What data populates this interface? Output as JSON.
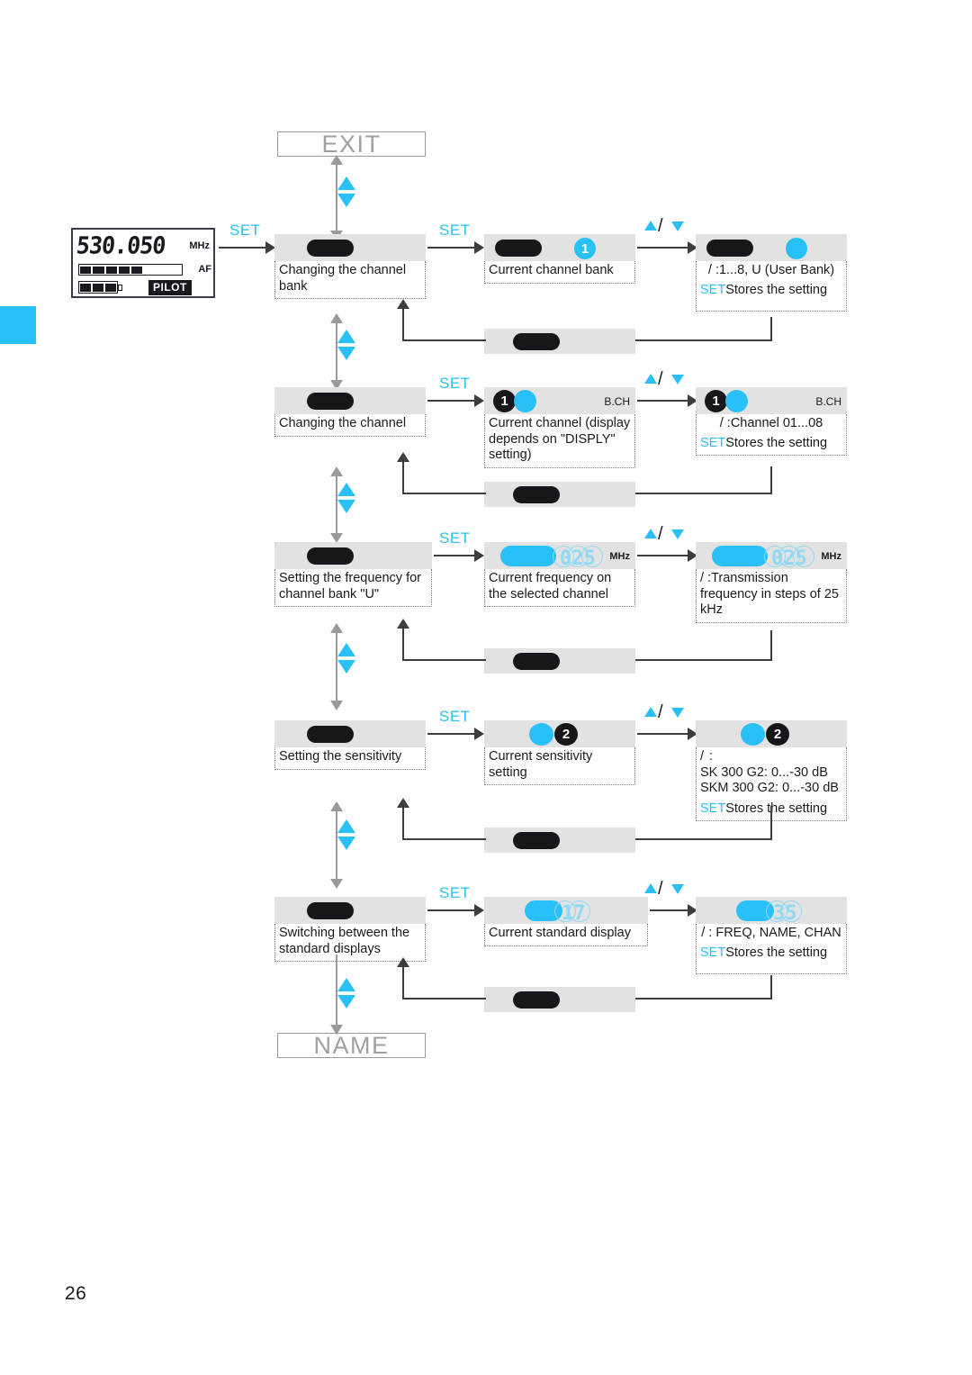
{
  "page": {
    "number": "26",
    "tab_color": "#29c0f7"
  },
  "lcd": {
    "frequency": "530.050",
    "unit": "MHz",
    "af_label": "AF",
    "pilot_label": "PILOT",
    "af_segments_on": 5,
    "af_segments_total": 8,
    "battery_segments_on": 3,
    "battery_segments_total": 3
  },
  "terminals": {
    "exit": "EXIT",
    "name": "NAME"
  },
  "labels": {
    "set": "SET",
    "updown": "/",
    "stores_prefix": "SET",
    "stores_text": "Stores the setting"
  },
  "rows": [
    {
      "id": "channel-bank",
      "menu_caption": "Changing the channel bank",
      "current_caption": "Current channel bank",
      "current_screen": {
        "badge": "1",
        "badge_color": "#29c0f7"
      },
      "edit_value": ":1...8, U (User Bank)",
      "edit_has_store": true,
      "screen_corner_label": ""
    },
    {
      "id": "channel",
      "menu_caption": "Changing the channel",
      "current_caption": "Current channel (display depends on \"DISPLY\" setting)",
      "current_screen": {
        "badge": "1",
        "badge_color": "#17171b"
      },
      "edit_value": ":Channel  01...08",
      "edit_has_store": true,
      "screen_corner_label": "B.CH"
    },
    {
      "id": "frequency",
      "menu_caption": "Setting the frequency for channel bank \"U\"",
      "current_caption": "Current frequency on the selected channel",
      "current_screen": {
        "ghost": "025",
        "unit": "MHz"
      },
      "edit_value": ":Transmission frequency in steps of 25 kHz",
      "edit_has_store": false,
      "screen_corner_label": ""
    },
    {
      "id": "sensitivity",
      "menu_caption": "Setting the sensitivity",
      "current_caption": "Current sensitivity setting",
      "current_screen": {
        "badge": "2",
        "badge_color": "#17171b"
      },
      "edit_value": ":",
      "edit_lines": [
        "SK 300 G2: 0...-30 dB",
        "SKM 300 G2: 0...-30 dB"
      ],
      "edit_has_store": true,
      "screen_corner_label": ""
    },
    {
      "id": "standard-display",
      "menu_caption": "Switching between the standard displays",
      "current_caption": "Current standard display",
      "current_screen": {
        "ghost": "17"
      },
      "edit_value": ": FREQ, NAME, CHAN",
      "edit_has_store": true,
      "screen_corner_label": ""
    }
  ]
}
